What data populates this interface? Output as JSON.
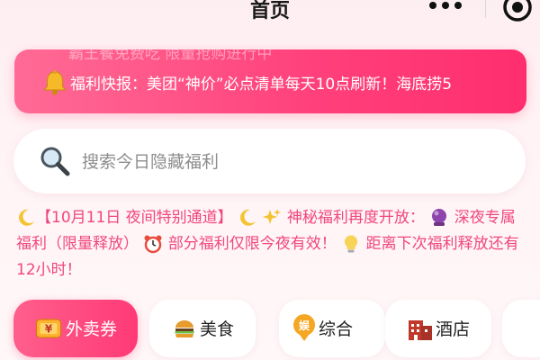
{
  "nav": {
    "title": "首页"
  },
  "ticker": {
    "text": "福利快报：美团“神价”必点清单每天10点刷新！海底捞5",
    "ghost_text": "霸王餐免费吃 限量抢购进行中"
  },
  "search": {
    "placeholder": "搜索今日隐藏福利",
    "value": ""
  },
  "notice": {
    "part1": "【10月11日 夜间特别通道】",
    "part2": "神秘福利再度开放：",
    "part3": "深夜专属福利（限量释放）",
    "part4": "部分福利仅限今夜有效！",
    "part5": "距离下次福利释放还有12小时！"
  },
  "categories": [
    {
      "label": "外卖券",
      "icon": "coupon-icon",
      "active": true
    },
    {
      "label": "美食",
      "icon": "burger-icon",
      "active": false
    },
    {
      "label": "综合",
      "icon": "yu-badge-icon",
      "active": false
    },
    {
      "label": "酒店",
      "icon": "hotel-icon",
      "active": false
    }
  ],
  "colors": {
    "accent": "#ff3f7b",
    "notice_text": "#f0467f",
    "background": "#fdeef1"
  }
}
